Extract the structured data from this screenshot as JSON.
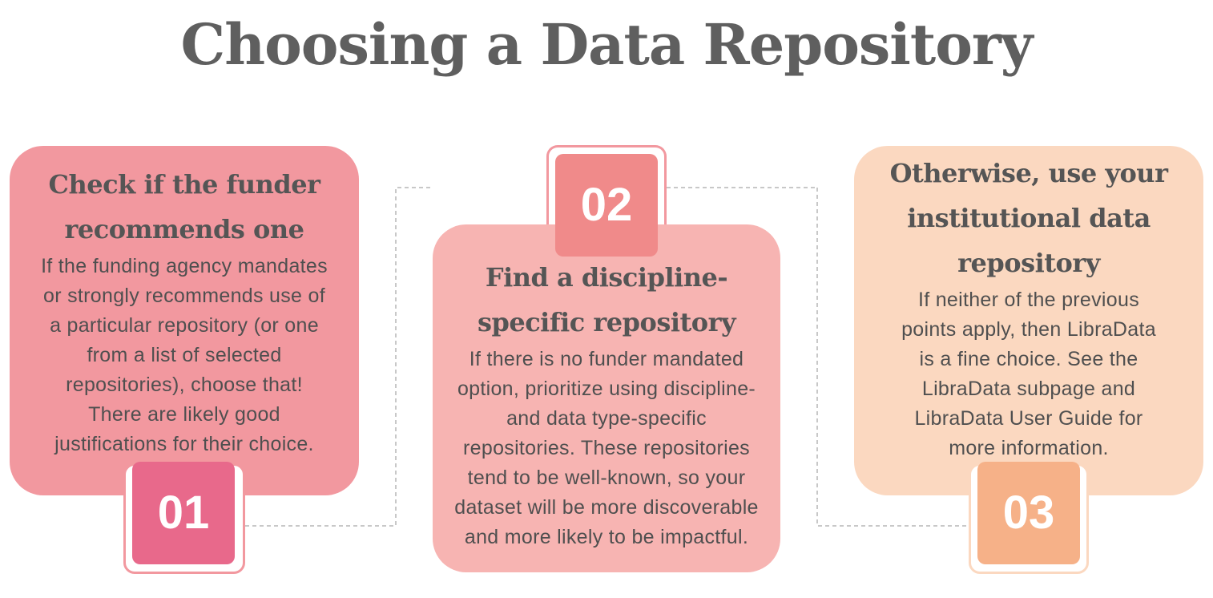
{
  "title": "Choosing a Data Repository",
  "steps": [
    {
      "number": "01",
      "heading_lines": [
        "Check if the funder",
        "recommends one"
      ],
      "body_lines": [
        "If the funding agency mandates",
        "or strongly recommends use of",
        "a particular repository (or one",
        "from a list of selected",
        "repositories), choose that!",
        "There are likely good",
        "justifications for their choice."
      ]
    },
    {
      "number": "02",
      "heading_lines": [
        "Find a discipline-",
        "specific repository"
      ],
      "body_lines": [
        "If there is no funder mandated",
        "option, prioritize using discipline-",
        "and data type-specific",
        "repositories. These repositories",
        "tend to be well-known, so your",
        "dataset will be more discoverable",
        "and more likely to be impactful."
      ]
    },
    {
      "number": "03",
      "heading_lines": [
        "Otherwise, use your",
        "institutional data",
        "repository"
      ],
      "body_lines": [
        "If neither of the previous",
        "points apply, then LibraData",
        "is a fine choice. See the",
        "LibraData subpage and",
        "LibraData User Guide for",
        "more information."
      ]
    }
  ],
  "colors": {
    "title": "#5f5f5f",
    "card_1": "#f2989f",
    "card_2": "#f7b4b2",
    "card_3": "#fbd8c0",
    "badge_1": "#e8698b",
    "badge_2": "#f08a8a",
    "badge_3": "#f6b188",
    "connector": "#c8c8c8"
  }
}
